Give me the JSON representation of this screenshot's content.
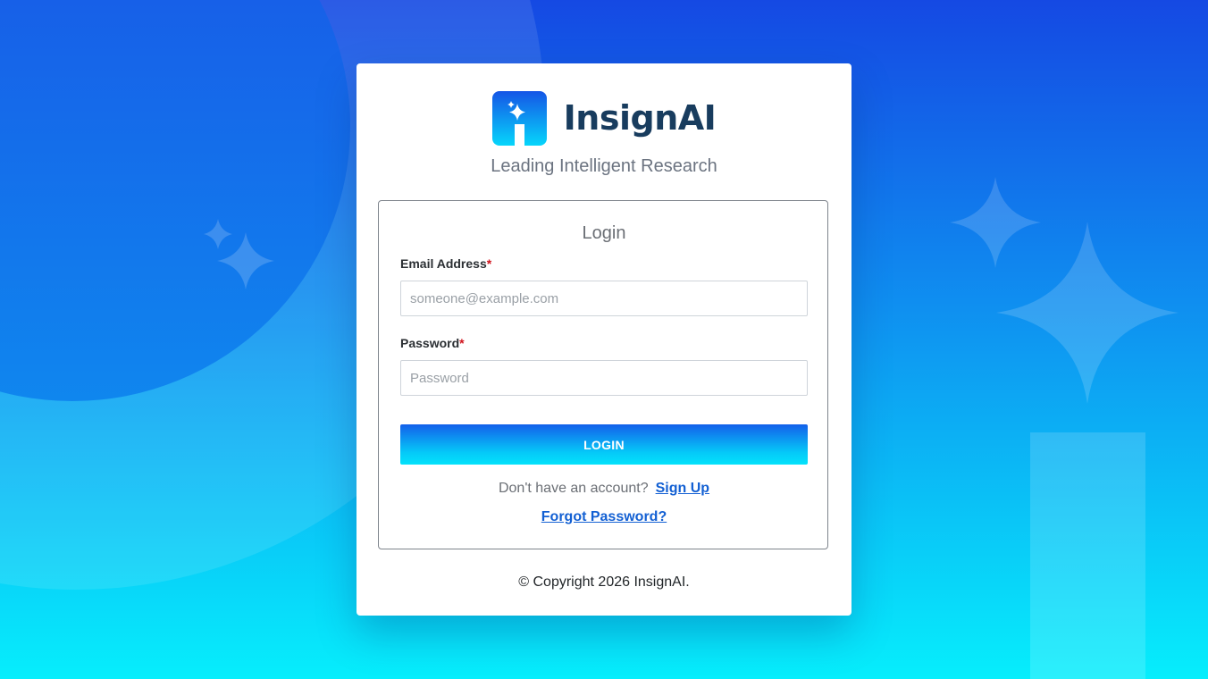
{
  "brand": {
    "name": "InsignAI",
    "tagline": "Leading Intelligent Research",
    "logo_icon": "sparkle-i-icon",
    "colors": {
      "primary": "#1549e3",
      "accent": "#06eefc",
      "wordmark": "#183c5e"
    }
  },
  "login": {
    "title": "Login",
    "email": {
      "label": "Email Address",
      "required_mark": "*",
      "placeholder": "someone@example.com",
      "value": ""
    },
    "password": {
      "label": "Password",
      "required_mark": "*",
      "placeholder": "Password",
      "value": ""
    },
    "submit_label": "LOGIN",
    "signup_prompt": "Don't have an account?",
    "signup_link": "Sign Up",
    "forgot_link": "Forgot Password?"
  },
  "footer": {
    "copyright": "© Copyright 2026 InsignAI."
  }
}
